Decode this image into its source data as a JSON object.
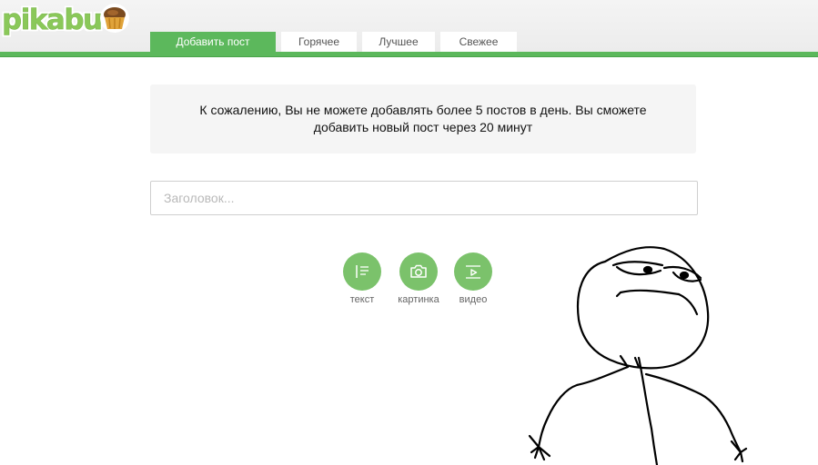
{
  "header": {
    "logo_text": "pikabu",
    "tabs": [
      {
        "label": "Добавить пост",
        "active": true
      },
      {
        "label": "Горячее",
        "active": false
      },
      {
        "label": "Лучшее",
        "active": false
      },
      {
        "label": "Свежее",
        "active": false
      }
    ]
  },
  "notice": {
    "text": "К сожалению, Вы не можете добавлять более 5 постов в день. Вы сможете добавить новый пост через 20 минут"
  },
  "post_form": {
    "title_placeholder": "Заголовок...",
    "title_value": "",
    "add_buttons": [
      {
        "label": "текст",
        "icon": "text-icon"
      },
      {
        "label": "картинка",
        "icon": "camera-icon"
      },
      {
        "label": "видео",
        "icon": "video-icon"
      }
    ]
  },
  "colors": {
    "brand_green": "#5cb85c",
    "button_green": "#7bc26b",
    "notice_bg": "#f5f5f5"
  }
}
